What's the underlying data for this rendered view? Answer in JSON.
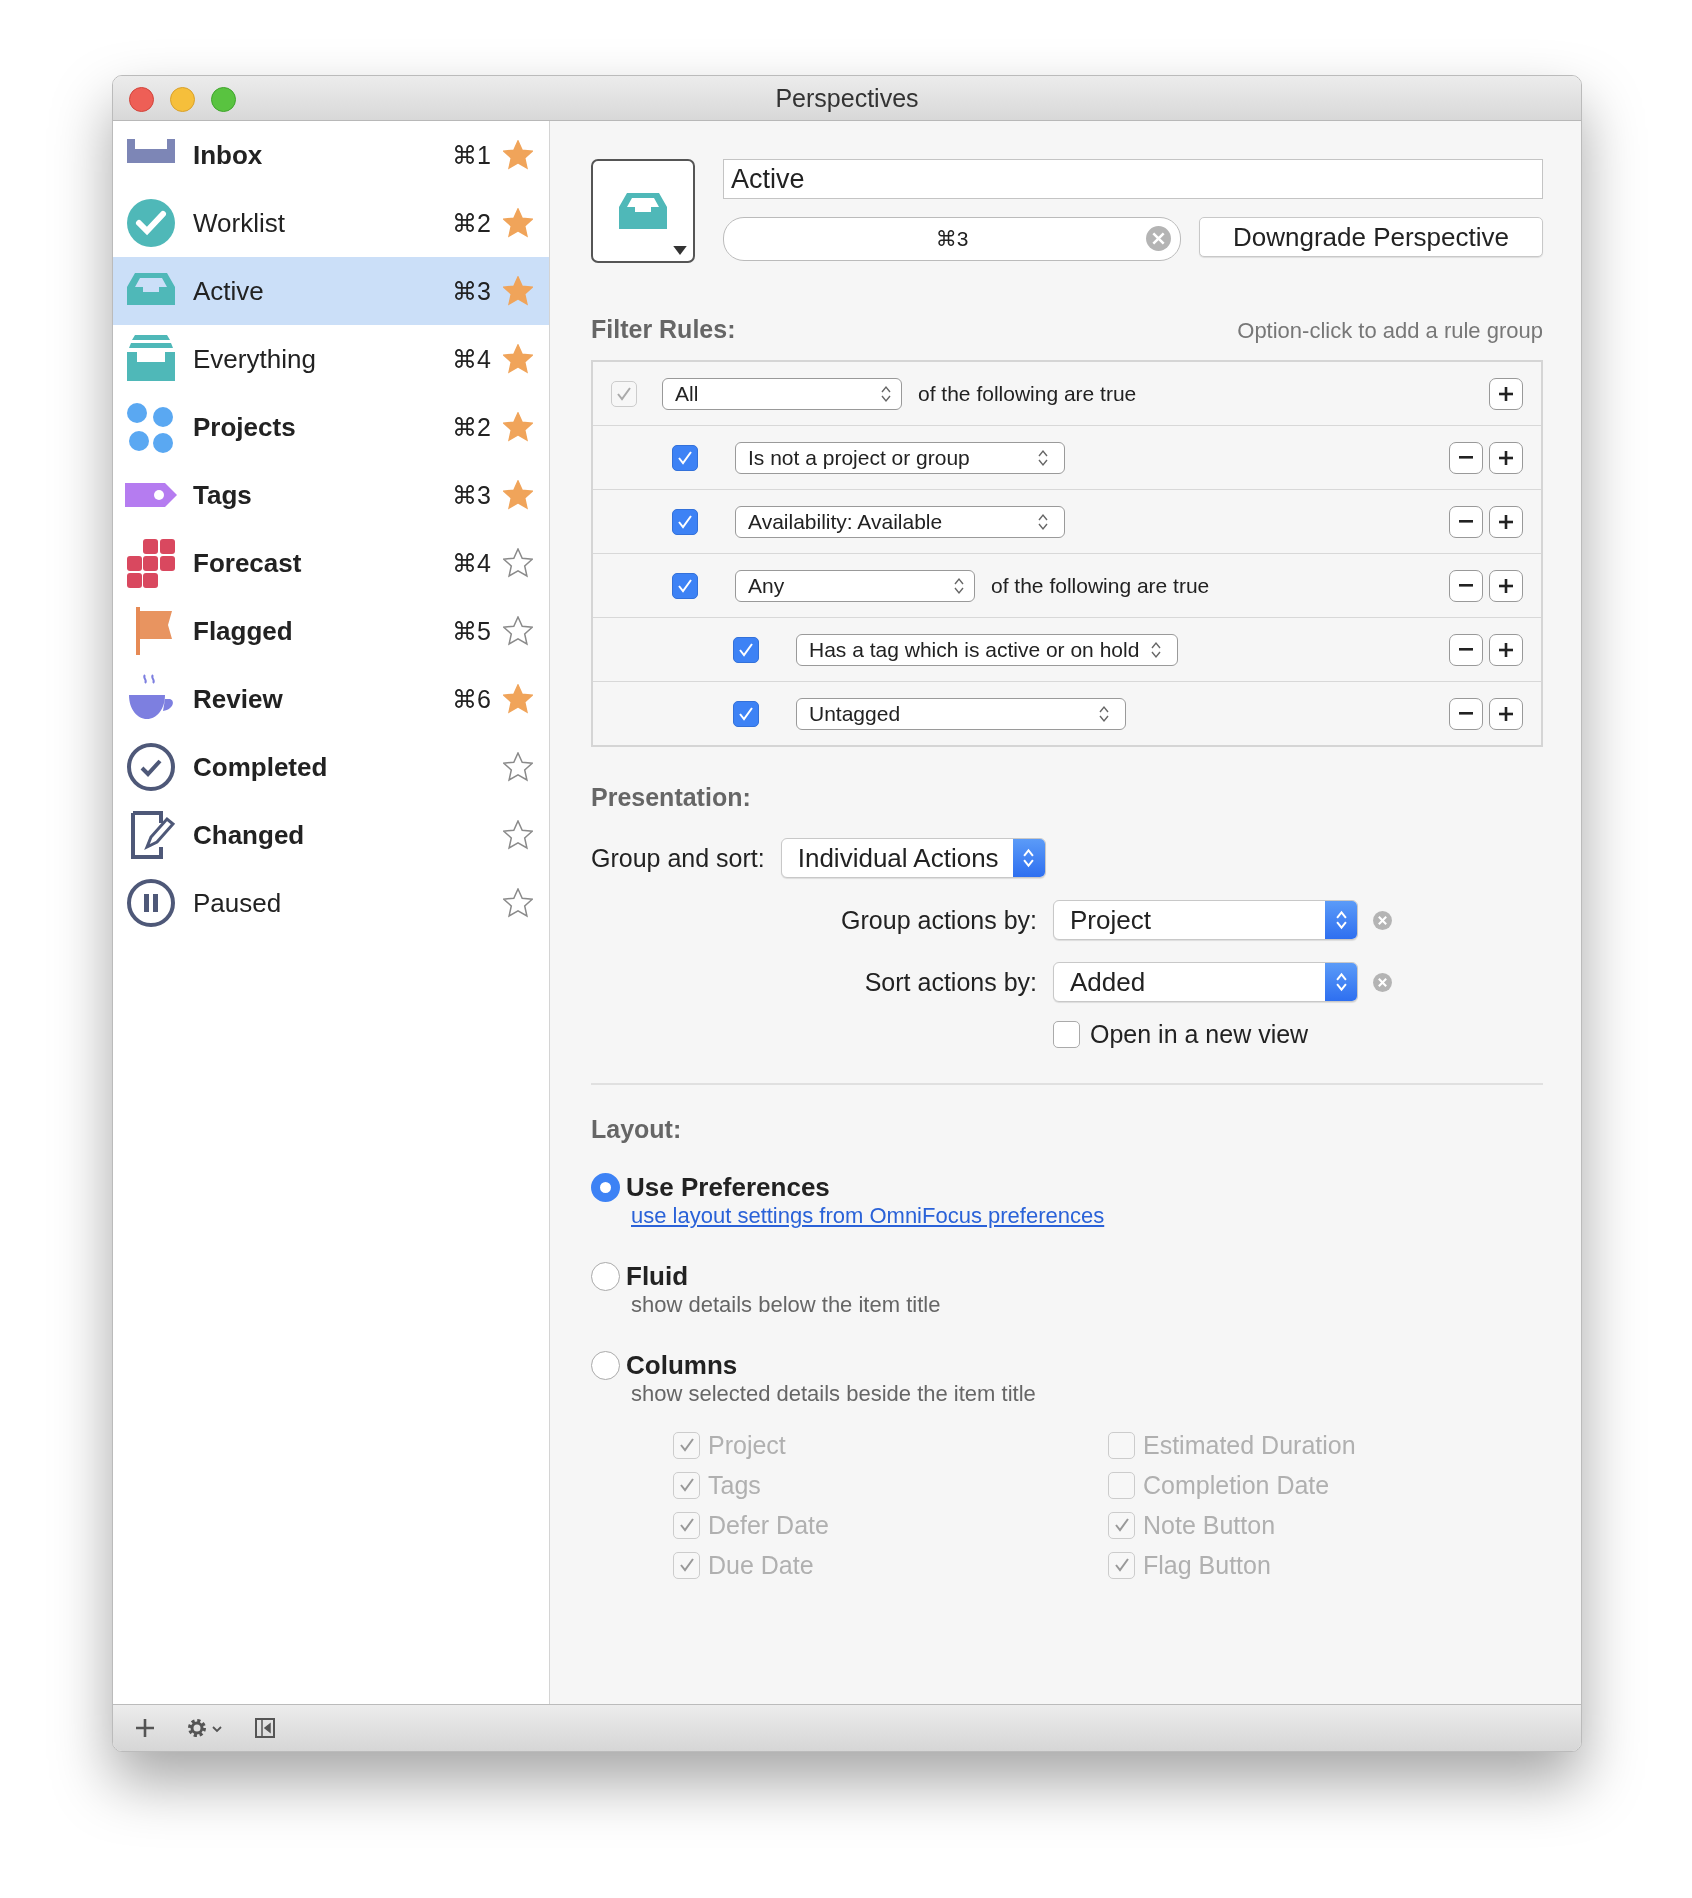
{
  "window": {
    "title": "Perspectives"
  },
  "sidebar": {
    "items": [
      {
        "label": "Inbox",
        "kind": "inbox",
        "shortcut": "⌘1",
        "starred": true,
        "emphasized": true,
        "selected": false
      },
      {
        "label": "Worklist",
        "kind": "check",
        "shortcut": "⌘2",
        "starred": true,
        "emphasized": false,
        "selected": false
      },
      {
        "label": "Active",
        "kind": "tray",
        "shortcut": "⌘3",
        "starred": true,
        "emphasized": false,
        "selected": true
      },
      {
        "label": "Everything",
        "kind": "stack",
        "shortcut": "⌘4",
        "starred": true,
        "emphasized": false,
        "selected": false
      },
      {
        "label": "Projects",
        "kind": "dots",
        "shortcut": "⌘2",
        "starred": true,
        "emphasized": true,
        "selected": false
      },
      {
        "label": "Tags",
        "kind": "tag",
        "shortcut": "⌘3",
        "starred": true,
        "emphasized": true,
        "selected": false
      },
      {
        "label": "Forecast",
        "kind": "grid",
        "shortcut": "⌘4",
        "starred": false,
        "emphasized": true,
        "selected": false
      },
      {
        "label": "Flagged",
        "kind": "flag",
        "shortcut": "⌘5",
        "starred": false,
        "emphasized": true,
        "selected": false
      },
      {
        "label": "Review",
        "kind": "cup",
        "shortcut": "⌘6",
        "starred": true,
        "emphasized": true,
        "selected": false
      },
      {
        "label": "Completed",
        "kind": "done",
        "starred": false,
        "emphasized": true,
        "selected": false
      },
      {
        "label": "Changed",
        "kind": "edit",
        "starred": false,
        "emphasized": true,
        "selected": false
      },
      {
        "label": "Paused",
        "kind": "pause",
        "starred": false,
        "emphasized": false,
        "selected": false
      }
    ]
  },
  "header": {
    "name": "Active",
    "shortcut": "⌘3",
    "button": "Downgrade Perspective"
  },
  "filter": {
    "title": "Filter Rules:",
    "hint": "Option-click to add a rule group",
    "rules": [
      {
        "kind": "group",
        "checked": true,
        "disabled": true,
        "value": "All",
        "text": "of the following are true",
        "children": [
          {
            "kind": "condition",
            "checked": true,
            "disabled": false,
            "value": "Is not a project or group"
          },
          {
            "kind": "condition",
            "checked": true,
            "disabled": false,
            "value": "Availability: Available"
          },
          {
            "kind": "group",
            "checked": true,
            "disabled": false,
            "value": "Any",
            "text": "of the following are true",
            "children": [
              {
                "kind": "condition",
                "checked": true,
                "disabled": false,
                "value": "Has a tag which is active or on hold"
              },
              {
                "kind": "condition",
                "checked": true,
                "disabled": false,
                "value": "Untagged"
              }
            ]
          }
        ]
      }
    ]
  },
  "presentation": {
    "title": "Presentation:",
    "group_and_sort_label": "Group and sort:",
    "group_and_sort": "Individual Actions",
    "group_by_label": "Group actions by:",
    "group_by": "Project",
    "sort_by_label": "Sort actions by:",
    "sort_by": "Added",
    "open_new_view": {
      "label": "Open in a new view",
      "checked": false
    }
  },
  "layout": {
    "title": "Layout:",
    "options": [
      {
        "title": "Use Preferences",
        "description": "use layout settings from OmniFocus preferences",
        "kind": "link",
        "selected": true
      },
      {
        "title": "Fluid",
        "description": "show details below the item title",
        "kind": "text",
        "selected": false
      },
      {
        "title": "Columns",
        "description": "show selected details beside the item title",
        "kind": "text",
        "selected": false
      }
    ],
    "columns": [
      {
        "label": "Project",
        "checked": true,
        "disabled": true
      },
      {
        "label": "Estimated Duration",
        "checked": false,
        "disabled": true
      },
      {
        "label": "Tags",
        "checked": true,
        "disabled": true
      },
      {
        "label": "Completion Date",
        "checked": false,
        "disabled": true
      },
      {
        "label": "Defer Date",
        "checked": true,
        "disabled": true
      },
      {
        "label": "Note Button",
        "checked": true,
        "disabled": true
      },
      {
        "label": "Due Date",
        "checked": true,
        "disabled": true
      },
      {
        "label": "Flag Button",
        "checked": true,
        "disabled": true
      }
    ]
  }
}
